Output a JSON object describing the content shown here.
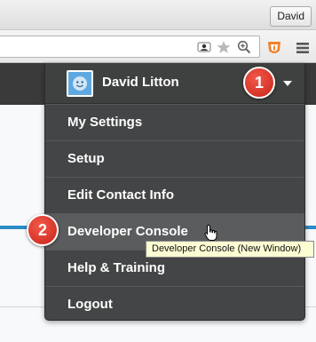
{
  "browser": {
    "profile_button": "David"
  },
  "user_menu": {
    "user_name": "David Litton",
    "items": [
      {
        "label": "My Settings"
      },
      {
        "label": "Setup"
      },
      {
        "label": "Edit Contact Info"
      },
      {
        "label": "Developer Console"
      },
      {
        "label": "Help & Training"
      },
      {
        "label": "Logout"
      }
    ]
  },
  "callouts": {
    "first": "1",
    "second": "2"
  },
  "tooltip": {
    "text": "Developer Console (New Window)"
  },
  "colors": {
    "menu_bg": "#444546",
    "menu_hover": "#5b5c5d",
    "badge": "#d6342a",
    "tooltip_bg": "#fdfdd4",
    "accent_blue": "#2a8bc4"
  },
  "icons": [
    "person-icon",
    "star-icon",
    "zoom-icon",
    "extension-icon",
    "hamburger-menu-icon",
    "avatar-icon",
    "caret-down-icon",
    "hand-cursor-icon"
  ]
}
